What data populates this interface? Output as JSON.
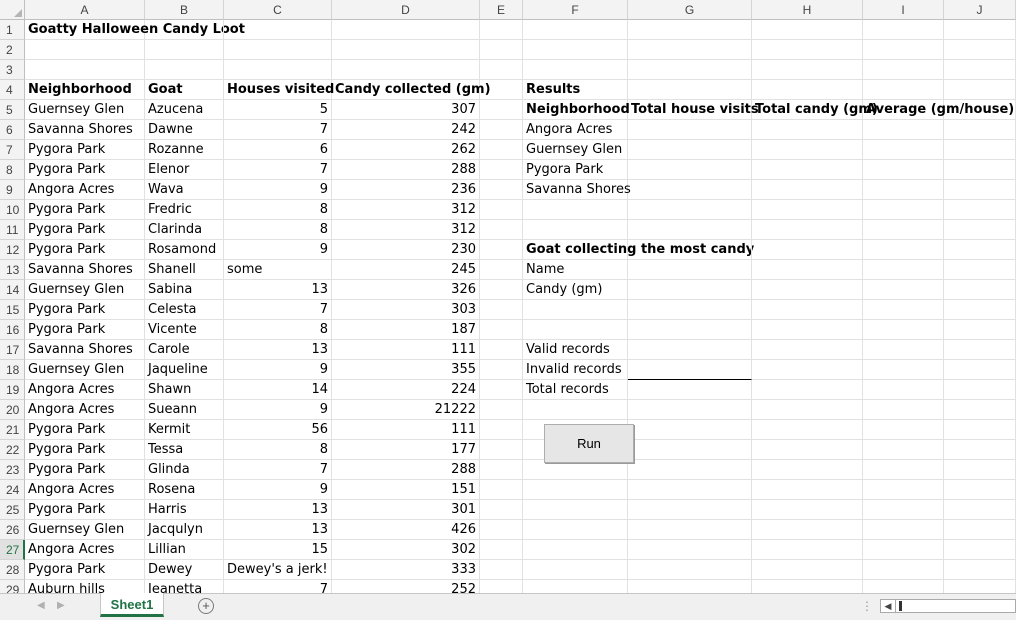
{
  "sheet": {
    "columns": [
      "A",
      "B",
      "C",
      "D",
      "E",
      "F",
      "G",
      "H",
      "I",
      "J"
    ],
    "rows": [
      "1",
      "2",
      "3",
      "4",
      "5",
      "6",
      "7",
      "8",
      "9",
      "10",
      "11",
      "12",
      "13",
      "14",
      "15",
      "16",
      "17",
      "18",
      "19",
      "20",
      "21",
      "22",
      "23",
      "24",
      "25",
      "26",
      "27",
      "28",
      "29"
    ],
    "title": "Goatty Halloween Candy Loot",
    "table_headers": {
      "neighborhood": "Neighborhood",
      "goat": "Goat",
      "houses": "Houses visited",
      "candy": "Candy collected (gm)"
    },
    "records": [
      {
        "neighborhood": "Guernsey Glen",
        "goat": "Azucena",
        "houses": "5",
        "candy": "307"
      },
      {
        "neighborhood": "Savanna Shores",
        "goat": "Dawne",
        "houses": "7",
        "candy": "242"
      },
      {
        "neighborhood": "Pygora Park",
        "goat": "Rozanne",
        "houses": "6",
        "candy": "262"
      },
      {
        "neighborhood": "Pygora Park",
        "goat": "Elenor",
        "houses": "7",
        "candy": "288"
      },
      {
        "neighborhood": "Angora Acres",
        "goat": "Wava",
        "houses": "9",
        "candy": "236"
      },
      {
        "neighborhood": "Pygora Park",
        "goat": "Fredric",
        "houses": "8",
        "candy": "312"
      },
      {
        "neighborhood": "Pygora Park",
        "goat": "Clarinda",
        "houses": "8",
        "candy": "312"
      },
      {
        "neighborhood": "Pygora Park",
        "goat": "Rosamond",
        "houses": "9",
        "candy": "230"
      },
      {
        "neighborhood": "Savanna Shores",
        "goat": "Shanell",
        "houses": "some",
        "candy": "245"
      },
      {
        "neighborhood": "Guernsey Glen",
        "goat": "Sabina",
        "houses": "13",
        "candy": "326"
      },
      {
        "neighborhood": "Pygora Park",
        "goat": "Celesta",
        "houses": "7",
        "candy": "303"
      },
      {
        "neighborhood": "Pygora Park",
        "goat": "Vicente",
        "houses": "8",
        "candy": "187"
      },
      {
        "neighborhood": " Savanna Shores",
        "goat": "Carole",
        "houses": "13",
        "candy": "111"
      },
      {
        "neighborhood": "Guernsey Glen",
        "goat": "Jaqueline",
        "houses": "9",
        "candy": "355"
      },
      {
        "neighborhood": "Angora Acres",
        "goat": "Shawn",
        "houses": "14",
        "candy": "224"
      },
      {
        "neighborhood": "Angora Acres",
        "goat": "Sueann",
        "houses": "9",
        "candy": "21222"
      },
      {
        "neighborhood": "Pygora Park",
        "goat": "Kermit",
        "houses": "56",
        "candy": "111"
      },
      {
        "neighborhood": "Pygora Park",
        "goat": "Tessa",
        "houses": "8",
        "candy": "177"
      },
      {
        "neighborhood": "Pygora Park",
        "goat": "Glinda",
        "houses": "7",
        "candy": "288"
      },
      {
        "neighborhood": "Angora Acres",
        "goat": "Rosena",
        "houses": "9",
        "candy": "151"
      },
      {
        "neighborhood": "Pygora Park",
        "goat": "Harris",
        "houses": "13",
        "candy": "301"
      },
      {
        "neighborhood": "Guernsey Glen",
        "goat": "Jacqulyn",
        "houses": "13",
        "candy": "426"
      },
      {
        "neighborhood": "Angora Acres",
        "goat": "Lillian",
        "houses": "15",
        "candy": "302"
      },
      {
        "neighborhood": "Pygora Park",
        "goat": "Dewey",
        "houses": "Dewey's a jerk!",
        "candy": "333"
      },
      {
        "neighborhood": "Auburn hills",
        "goat": "Jeanetta",
        "houses": "7",
        "candy": "252"
      }
    ],
    "results": {
      "title": "Results",
      "headers": [
        "Neighborhood",
        "Total house visits",
        "Total candy (gm)",
        "Average (gm/house)"
      ],
      "neighborhoods": [
        "Angora Acres",
        "Guernsey Glen",
        "Pygora Park",
        "Savanna Shores"
      ],
      "most_title": "Goat collecting the most candy",
      "name_label": "Name",
      "candy_label": "Candy (gm)",
      "valid_label": "Valid records",
      "invalid_label": "Invalid records",
      "total_label": "Total records"
    },
    "active_row": "27"
  },
  "run_button": {
    "label": "Run"
  },
  "tabs": {
    "sheet_name": "Sheet1",
    "add_label": "+"
  },
  "colors": {
    "accent": "#217346"
  }
}
